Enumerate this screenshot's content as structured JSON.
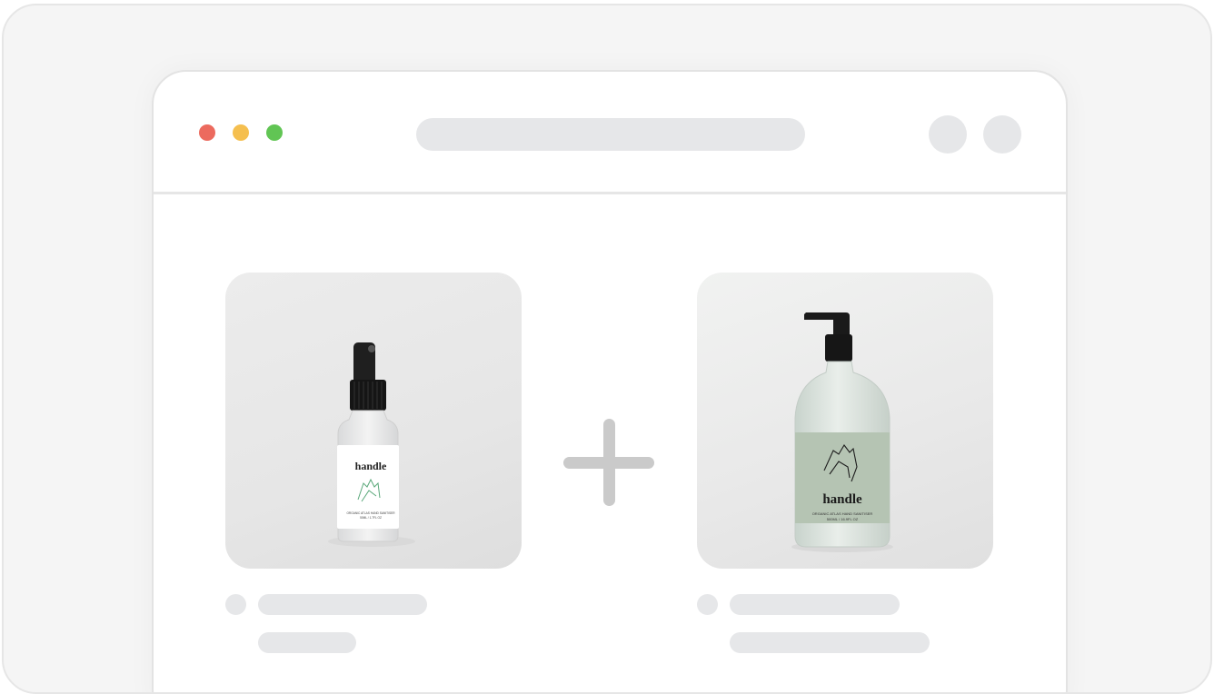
{
  "window": {
    "controls": {
      "close_color": "#ec6a5e",
      "minimize_color": "#f5bf4f",
      "maximize_color": "#61c554"
    },
    "address_bar": "",
    "toolbar_buttons": [
      "circle-button",
      "circle-button"
    ]
  },
  "products": [
    {
      "brand": "handle",
      "label_line1": "ORGANIC ATLAS HAND SANITISER",
      "label_line2": "50ML / 1.7FL OZ",
      "type": "spray-bottle",
      "label_color": "#ffffff"
    },
    {
      "brand": "handle",
      "label_line1": "ORGANIC ATLAS HAND SANITISER",
      "label_line2": "500ML / 16.9FL OZ",
      "type": "pump-bottle",
      "label_color": "#b5c4b3"
    }
  ],
  "combine_icon": "plus-icon",
  "colors": {
    "placeholder": "#e6e7e9",
    "plus": "#cacaca"
  }
}
